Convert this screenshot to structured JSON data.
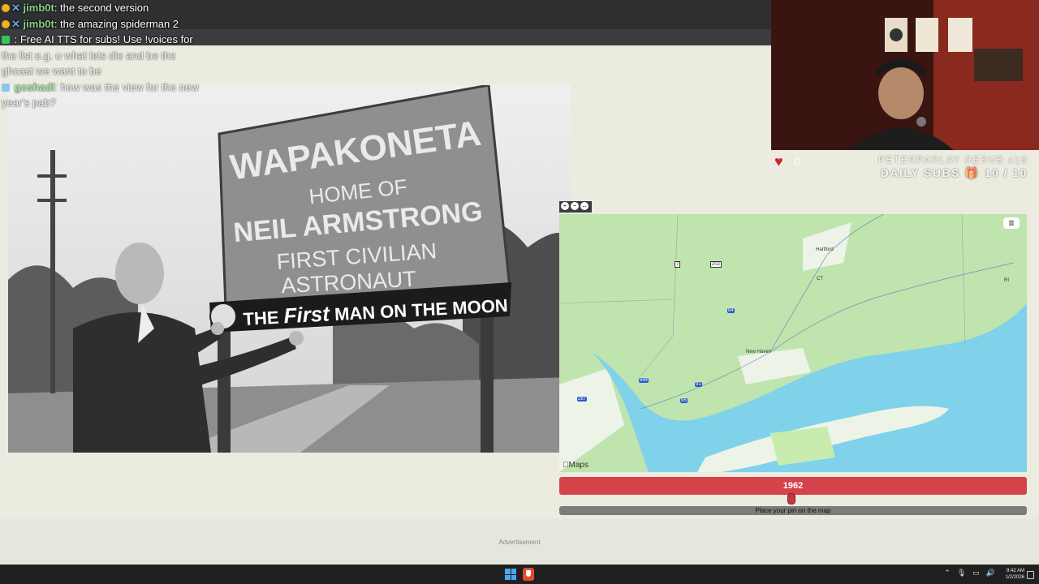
{
  "chat": {
    "lines": [
      {
        "user": "jimb0t",
        "message": ": the second version",
        "badge": "gold"
      },
      {
        "user": "jimb0t",
        "message": ": the amazing spiderman 2",
        "badge": "gold"
      },
      {
        "user": "",
        "message": ": Free AI TTS for subs! Use !voices for",
        "badge": "green"
      },
      {
        "user": "",
        "message": "the list e.g. u what lets die and be the",
        "badge": ""
      },
      {
        "user": "",
        "message": "ghoast we want to be",
        "badge": ""
      },
      {
        "user": "goshadi",
        "message": ": how was the view for the new",
        "badge": "blue"
      },
      {
        "user": "",
        "message": "year's pab?",
        "badge": ""
      }
    ]
  },
  "photo": {
    "alt_text_hidden": true,
    "sign": {
      "line1": "WAPAKONETA",
      "line2": "HOME OF",
      "line3": "NEIL ARMSTRONG",
      "line4": "FIRST CIVILIAN",
      "line5": "ASTRONAUT",
      "banner_prefix": "THE",
      "banner_em": "First",
      "banner_suffix": "MAN ON THE MOON"
    }
  },
  "map": {
    "labels": {
      "hartford": "Hartford",
      "ct": "CT",
      "ri": "RI",
      "new_haven": "New Haven",
      "route_7": "7",
      "route_202": "202",
      "route_84": "84",
      "route_91": "91",
      "route_95": "95",
      "route_287": "287",
      "route_684": "684"
    },
    "attribution": "Maps",
    "water_color": "#7fd2ea",
    "land_color": "#bfe4ae"
  },
  "guess": {
    "year": "1962",
    "pin_instruction": "Place your pin on the map"
  },
  "ad": {
    "label": "Advertisement"
  },
  "stream": {
    "heart_count": "0",
    "resub_text": "PETERPARLAY RESUB x16",
    "daily_subs_label": "DAILY SUBS",
    "daily_subs_value": "10 / 10"
  },
  "taskbar": {
    "time": "9:42 AM",
    "date": "1/2/2026"
  }
}
